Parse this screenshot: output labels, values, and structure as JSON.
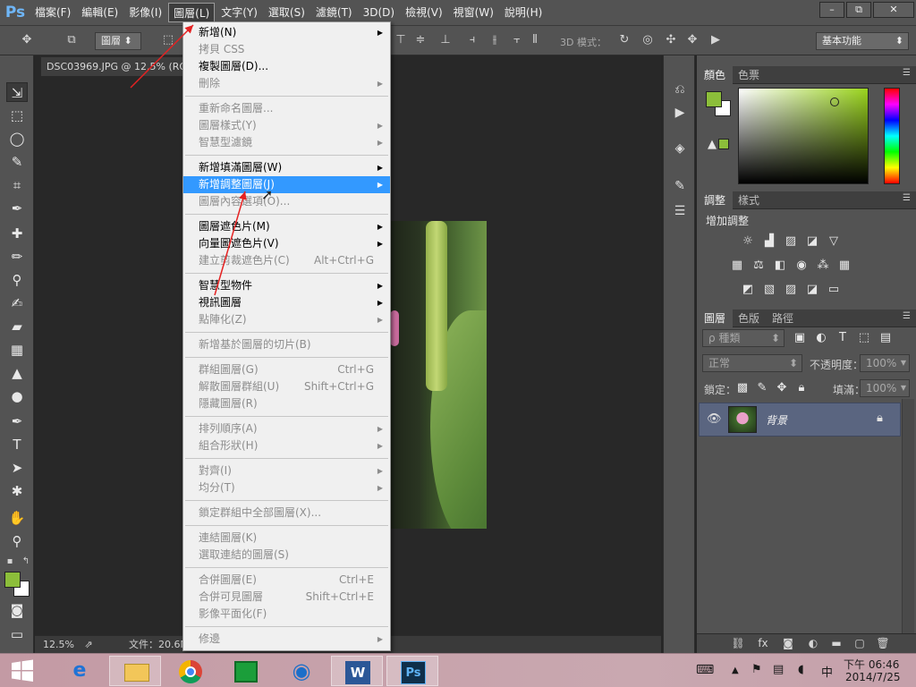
{
  "app": {
    "logo": "Ps"
  },
  "menubar": {
    "items": [
      "檔案(F)",
      "編輯(E)",
      "影像(I)",
      "圖層(L)",
      "文字(Y)",
      "選取(S)",
      "濾鏡(T)",
      "3D(D)",
      "檢視(V)",
      "視窗(W)",
      "說明(H)"
    ],
    "active_index": 3
  },
  "window_controls": {
    "minimize": "–",
    "restore": "⧉",
    "close": "✕"
  },
  "options_bar": {
    "layer_select": "圖層",
    "mode_3d_label": "3D 模式：",
    "workspace": "基本功能"
  },
  "document": {
    "tab_title": "DSC03969.JPG @ 12.5% (RG",
    "zoom": "12.5%",
    "doc_size": "文件：20.6M"
  },
  "layer_menu": {
    "groups": [
      [
        {
          "label": "新增(N)",
          "disabled": false,
          "submenu": true
        },
        {
          "label": "拷貝 CSS",
          "disabled": true,
          "submenu": false
        },
        {
          "label": "複製圖層(D)...",
          "disabled": false,
          "submenu": false
        },
        {
          "label": "刪除",
          "disabled": true,
          "submenu": true
        }
      ],
      [
        {
          "label": "重新命名圖層...",
          "disabled": true,
          "submenu": false
        },
        {
          "label": "圖層樣式(Y)",
          "disabled": true,
          "submenu": true
        },
        {
          "label": "智慧型濾鏡",
          "disabled": true,
          "submenu": true
        }
      ],
      [
        {
          "label": "新增填滿圖層(W)",
          "disabled": false,
          "submenu": true
        },
        {
          "label": "新增調整圖層(J)",
          "disabled": false,
          "submenu": true,
          "highlighted": true
        },
        {
          "label": "圖層內容選項(O)...",
          "disabled": true,
          "submenu": false
        }
      ],
      [
        {
          "label": "圖層遮色片(M)",
          "disabled": false,
          "submenu": true
        },
        {
          "label": "向量圖遮色片(V)",
          "disabled": false,
          "submenu": true
        },
        {
          "label": "建立剪裁遮色片(C)",
          "disabled": true,
          "submenu": false,
          "shortcut": "Alt+Ctrl+G"
        }
      ],
      [
        {
          "label": "智慧型物件",
          "disabled": false,
          "submenu": true
        },
        {
          "label": "視訊圖層",
          "disabled": false,
          "submenu": true
        },
        {
          "label": "點陣化(Z)",
          "disabled": true,
          "submenu": true
        }
      ],
      [
        {
          "label": "新增基於圖層的切片(B)",
          "disabled": true,
          "submenu": false
        }
      ],
      [
        {
          "label": "群組圖層(G)",
          "disabled": true,
          "submenu": false,
          "shortcut": "Ctrl+G"
        },
        {
          "label": "解散圖層群組(U)",
          "disabled": true,
          "submenu": false,
          "shortcut": "Shift+Ctrl+G"
        },
        {
          "label": "隱藏圖層(R)",
          "disabled": true,
          "submenu": false
        }
      ],
      [
        {
          "label": "排列順序(A)",
          "disabled": true,
          "submenu": true
        },
        {
          "label": "組合形狀(H)",
          "disabled": true,
          "submenu": true
        }
      ],
      [
        {
          "label": "對齊(I)",
          "disabled": true,
          "submenu": true
        },
        {
          "label": "均分(T)",
          "disabled": true,
          "submenu": true
        }
      ],
      [
        {
          "label": "鎖定群組中全部圖層(X)...",
          "disabled": true,
          "submenu": false
        }
      ],
      [
        {
          "label": "連結圖層(K)",
          "disabled": true,
          "submenu": false
        },
        {
          "label": "選取連結的圖層(S)",
          "disabled": true,
          "submenu": false
        }
      ],
      [
        {
          "label": "合併圖層(E)",
          "disabled": true,
          "submenu": false,
          "shortcut": "Ctrl+E"
        },
        {
          "label": "合併可見圖層",
          "disabled": true,
          "submenu": false,
          "shortcut": "Shift+Ctrl+E"
        },
        {
          "label": "影像平面化(F)",
          "disabled": true,
          "submenu": false
        }
      ],
      [
        {
          "label": "修邊",
          "disabled": true,
          "submenu": true
        }
      ]
    ]
  },
  "panels": {
    "color_tabs": [
      "顏色",
      "色票"
    ],
    "adjust_tabs": [
      "調整",
      "樣式"
    ],
    "adjust_title": "增加調整",
    "layers_tabs": [
      "圖層",
      "色版",
      "路徑"
    ],
    "kind_filter": "ρ 種類",
    "blend_mode": "正常",
    "opacity_label": "不透明度：",
    "opacity_value": "100%",
    "lock_label": "鎖定：",
    "fill_label": "填滿：",
    "fill_value": "100%",
    "layer_name": "背景",
    "colors": {
      "foreground": "#8cbe3a",
      "background": "#ffffff",
      "selection": "#3399ff"
    }
  },
  "taskbar": {
    "time": "下午 06:46",
    "date": "2014/7/25",
    "ime": "中",
    "apps": [
      "internet-explorer",
      "file-explorer",
      "chrome",
      "store",
      "messenger",
      "word",
      "photoshop"
    ],
    "word_label": "W",
    "ps_label": "Ps"
  }
}
